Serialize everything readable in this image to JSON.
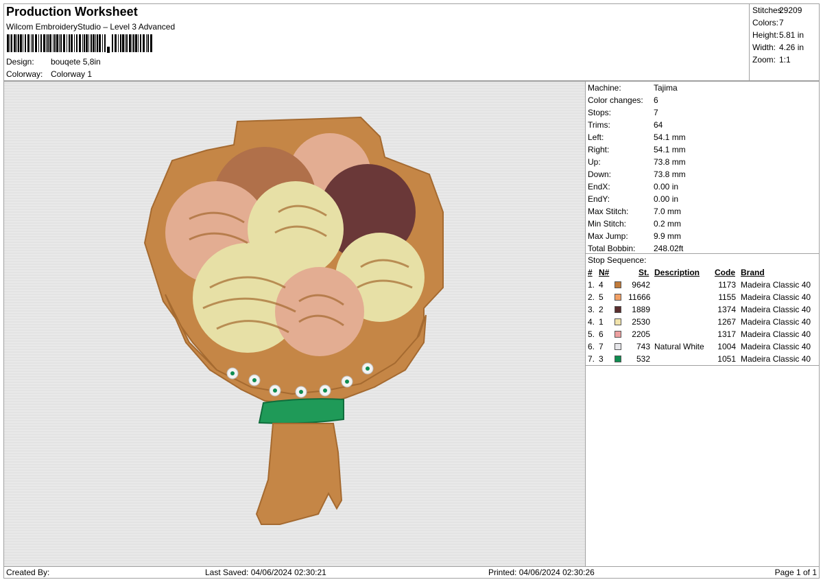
{
  "header": {
    "title": "Production Worksheet",
    "subtitle": "Wilcom EmbroideryStudio – Level 3 Advanced",
    "design_label": "Design:",
    "design_value": "bouqete 5,8in",
    "colorway_label": "Colorway:",
    "colorway_value": "Colorway 1"
  },
  "summary": [
    {
      "label": "Stitches:",
      "value": "29209"
    },
    {
      "label": "Colors:",
      "value": "7"
    },
    {
      "label": "Height:",
      "value": "5.81 in"
    },
    {
      "label": "Width:",
      "value": "4.26 in"
    },
    {
      "label": "Zoom:",
      "value": "1:1"
    }
  ],
  "machine": [
    {
      "label": "Machine:",
      "value": "Tajima"
    },
    {
      "label": "Color changes:",
      "value": "6"
    },
    {
      "label": "Stops:",
      "value": "7"
    },
    {
      "label": "Trims:",
      "value": "64"
    },
    {
      "label": "Left:",
      "value": "54.1 mm"
    },
    {
      "label": "Right:",
      "value": "54.1 mm"
    },
    {
      "label": "Up:",
      "value": "73.8 mm"
    },
    {
      "label": "Down:",
      "value": "73.8 mm"
    },
    {
      "label": "EndX:",
      "value": "0.00 in"
    },
    {
      "label": "EndY:",
      "value": "0.00 in"
    },
    {
      "label": "Max Stitch:",
      "value": "7.0 mm"
    },
    {
      "label": "Min Stitch:",
      "value": "0.2 mm"
    },
    {
      "label": "Max Jump:",
      "value": "9.9 mm"
    },
    {
      "label": "Total Bobbin:",
      "value": "248.02ft"
    }
  ],
  "stop_sequence": {
    "title": "Stop Sequence:",
    "headers": {
      "num": "#",
      "needle": "N#",
      "stitches": "St.",
      "description": "Description",
      "code": "Code",
      "brand": "Brand"
    },
    "rows": [
      {
        "num": "1.",
        "needle": "4",
        "color": "#c07a3a",
        "stitches": "9642",
        "description": "",
        "code": "1173",
        "brand": "Madeira Classic 40"
      },
      {
        "num": "2.",
        "needle": "5",
        "color": "#f2a065",
        "stitches": "11666",
        "description": "",
        "code": "1155",
        "brand": "Madeira Classic 40"
      },
      {
        "num": "3.",
        "needle": "2",
        "color": "#5a2e2e",
        "stitches": "1889",
        "description": "",
        "code": "1374",
        "brand": "Madeira Classic 40"
      },
      {
        "num": "4.",
        "needle": "1",
        "color": "#f1e3ab",
        "stitches": "2530",
        "description": "",
        "code": "1267",
        "brand": "Madeira Classic 40"
      },
      {
        "num": "5.",
        "needle": "6",
        "color": "#eda0a0",
        "stitches": "2205",
        "description": "",
        "code": "1317",
        "brand": "Madeira Classic 40"
      },
      {
        "num": "6.",
        "needle": "7",
        "color": "#e6e6ea",
        "stitches": "743",
        "description": "Natural White",
        "code": "1004",
        "brand": "Madeira Classic 40"
      },
      {
        "num": "7.",
        "needle": "3",
        "color": "#0f8c50",
        "stitches": "532",
        "description": "",
        "code": "1051",
        "brand": "Madeira Classic 40"
      }
    ]
  },
  "footer": {
    "created_by": "Created By:",
    "last_saved": "Last Saved: 04/06/2024 02:30:21",
    "printed": "Printed: 04/06/2024 02:30:26",
    "page": "Page 1 of 1"
  }
}
